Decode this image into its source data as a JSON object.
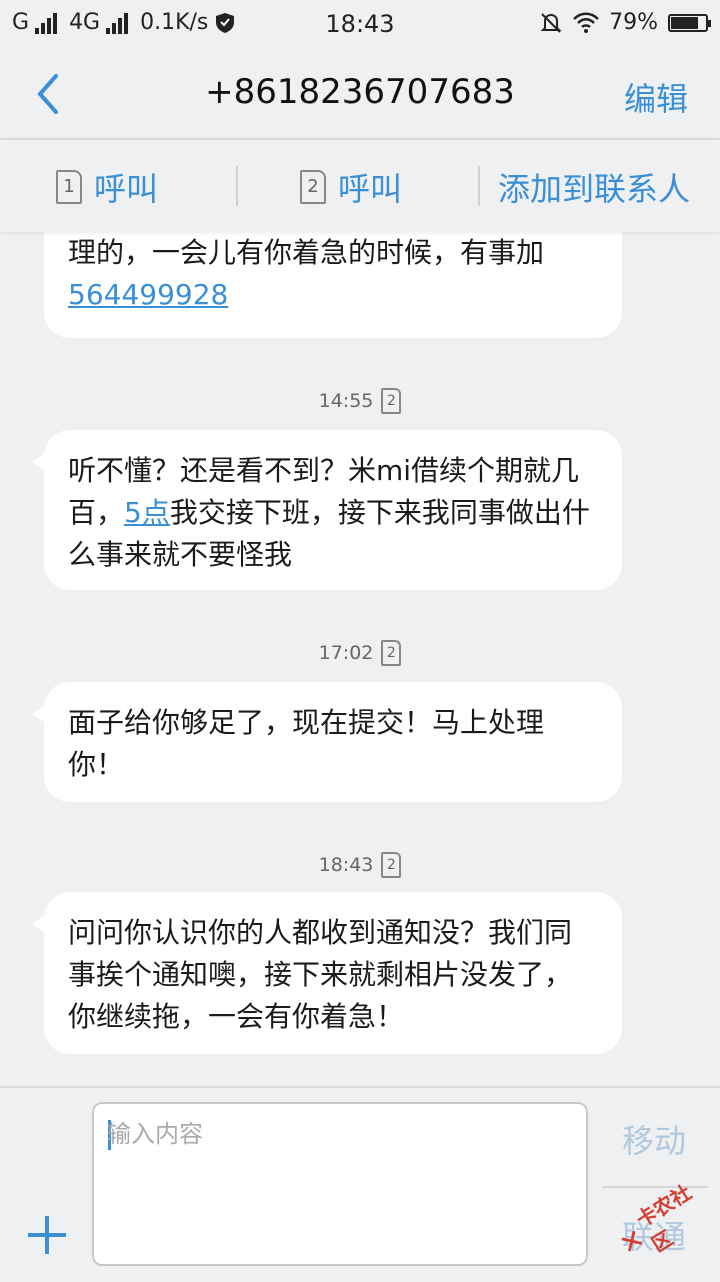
{
  "status_bar": {
    "carrier1": "G",
    "network": "4G",
    "speed": "0.1K/s",
    "time": "18:43",
    "battery": "79%",
    "battery_level": 0.79
  },
  "header": {
    "title": "+8618236707683",
    "edit_label": "编辑"
  },
  "actions": {
    "sim1_number": "1",
    "sim1_call": "呼叫",
    "sim2_number": "2",
    "sim2_call": "呼叫",
    "add_contact": "添加到联系人"
  },
  "messages": [
    {
      "text_a": "理的，一会儿有你着急的时候，有事加",
      "link": "564499928"
    },
    {
      "time": "14:55",
      "sim": "2",
      "text_a": "听不懂？还是看不到？米mi借续个期就几百，",
      "link": "5点",
      "text_b": "我交接下班，接下来我同事做出什么事来就不要怪我"
    },
    {
      "time": "17:02",
      "sim": "2",
      "text_a": "面子给你够足了，现在提交！马上处理你！"
    },
    {
      "time": "18:43",
      "sim": "2",
      "text_a": "问问你认识你的人都收到通知没？我们同事挨个通知噢，接下来就剩相片没发了，你继续拖，一会有你着急！"
    }
  ],
  "composer": {
    "placeholder": "输入内容",
    "send_label": "移动",
    "send_label_2": "联通"
  },
  "watermark": {
    "text": "卡农社区"
  },
  "colors": {
    "accent": "#3a8fd6",
    "background": "#eff0f2",
    "bubble": "#ffffff"
  }
}
